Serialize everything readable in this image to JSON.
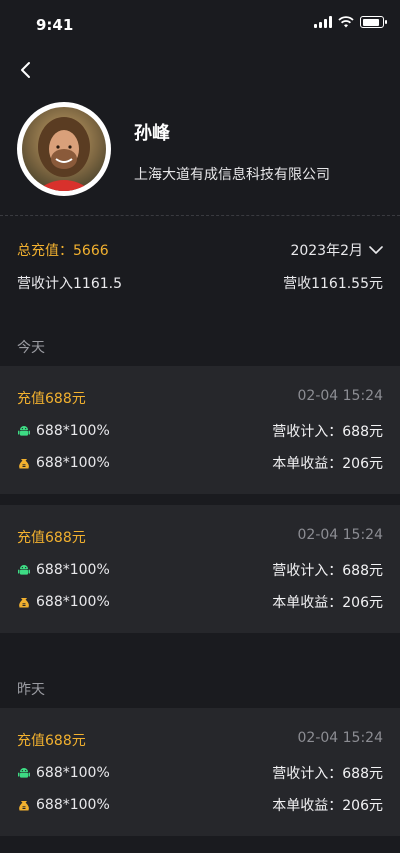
{
  "status": {
    "time": "9:41"
  },
  "profile": {
    "name": "孙峰",
    "company": "上海大道有成信息科技有限公司"
  },
  "summary": {
    "total_recharge_label": "总充值：",
    "total_recharge_value": "5666",
    "month": "2023年2月",
    "revenue_in_label": "营收计入1161.5",
    "revenue_label": "营收1161.55元"
  },
  "sections": [
    {
      "label": "今天"
    },
    {
      "label": "昨天"
    }
  ],
  "records": [
    {
      "title": "充值688元",
      "time": "02-04 15:24",
      "row1_left": "688*100%",
      "row1_right": "营收计入：688元",
      "row2_left": "688*100%",
      "row2_right": "本单收益：206元"
    },
    {
      "title": "充值688元",
      "time": "02-04 15:24",
      "row1_left": "688*100%",
      "row1_right": "营收计入：688元",
      "row2_left": "688*100%",
      "row2_right": "本单收益：206元"
    },
    {
      "title": "充值688元",
      "time": "02-04 15:24",
      "row1_left": "688*100%",
      "row1_right": "营收计入：688元",
      "row2_left": "688*100%",
      "row2_right": "本单收益：206元"
    }
  ],
  "icons": {
    "back": "chevron-left-icon",
    "month_dropdown": "chevron-down-icon",
    "row1": "android-icon",
    "row2": "money-bag-icon"
  },
  "colors": {
    "background": "#1a1b1f",
    "card": "#26272b",
    "accent": "#f2b12f",
    "android": "#3ddc84"
  },
  "battery_level": 0.9
}
